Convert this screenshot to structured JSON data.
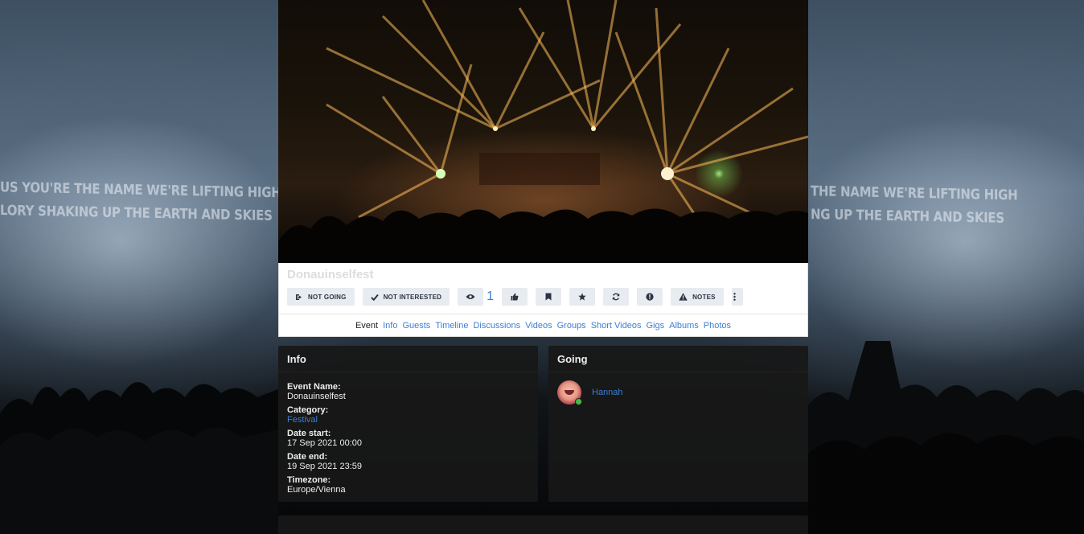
{
  "background": {
    "lyrics_left": [
      "US YOU'RE THE NAME WE'RE LIFTING HIGH",
      "LORY SHAKING UP THE EARTH AND SKIES"
    ],
    "lyrics_right": [
      "THE NAME WE'RE LIFTING HIGH",
      "NG UP THE EARTH AND SKIES"
    ]
  },
  "event": {
    "title": "Donauinselfest",
    "actions": {
      "not_going": "NOT GOING",
      "not_interested": "NOT INTERESTED",
      "views_count": "1",
      "notes": "NOTES"
    },
    "icons": {
      "not_going": "sign-out-icon",
      "not_interested": "check-icon",
      "views": "eye-icon",
      "like": "thumbs-up-icon",
      "bookmark": "bookmark-icon",
      "favorite": "star-icon",
      "refresh": "refresh-icon",
      "report": "exclamation-circle-icon",
      "notes": "warning-triangle-icon",
      "more": "vertical-ellipsis-icon"
    }
  },
  "tabs": [
    {
      "label": "Event",
      "active": true
    },
    {
      "label": "Info"
    },
    {
      "label": "Guests"
    },
    {
      "label": "Timeline"
    },
    {
      "label": "Discussions"
    },
    {
      "label": "Videos"
    },
    {
      "label": "Groups"
    },
    {
      "label": "Short Videos"
    },
    {
      "label": "Gigs"
    },
    {
      "label": "Albums"
    },
    {
      "label": "Photos"
    }
  ],
  "info_panel": {
    "title": "Info",
    "event_name_label": "Event Name:",
    "event_name": "Donauinselfest",
    "category_label": "Category:",
    "category": "Festival",
    "date_start_label": "Date start:",
    "date_start": "17 Sep 2021 00:00",
    "date_end_label": "Date end:",
    "date_end": "19 Sep 2021 23:59",
    "timezone_label": "Timezone:",
    "timezone": "Europe/Vienna"
  },
  "going_panel": {
    "title": "Going",
    "attendees": [
      {
        "name": "Hannah",
        "online": true
      }
    ]
  },
  "colors": {
    "link": "#3a7fd5",
    "button_bg": "#e8ebf0",
    "panel_bg": "#181818",
    "online": "#3fbf45"
  }
}
